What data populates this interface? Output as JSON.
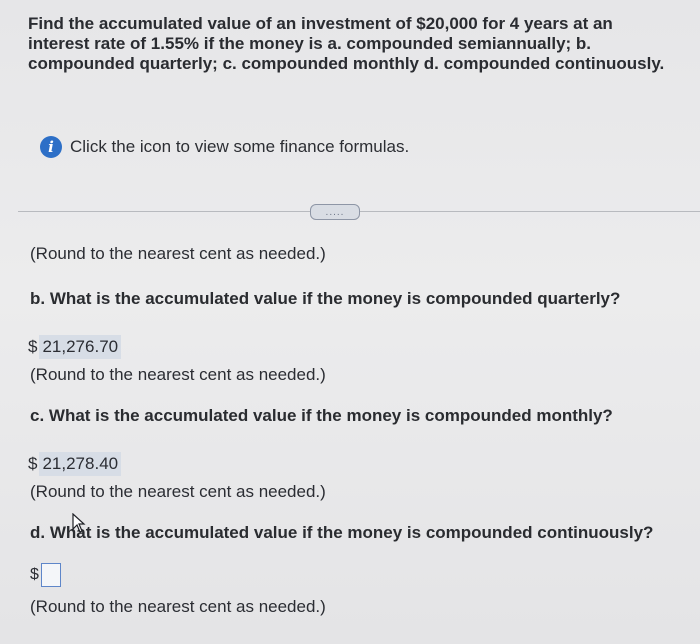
{
  "question": {
    "text": "Find the accumulated value of an investment of $20,000 for 4 years at an interest rate of 1.55% if the money is a. compounded semiannually; b. compounded quarterly; c. compounded monthly d. compounded continuously."
  },
  "help": {
    "icon_glyph": "i",
    "text": "Click the icon to view some finance formulas."
  },
  "expand_button": {
    "label": "....."
  },
  "part_a": {
    "round_note": "(Round to the nearest cent as needed.)"
  },
  "part_b": {
    "prompt": "b. What is the accumulated value if the money is compounded quarterly?",
    "currency": "$",
    "answer": "21,276.70",
    "round_note": "(Round to the nearest cent as needed.)"
  },
  "part_c": {
    "prompt": "c. What is the accumulated value if the money is compounded monthly?",
    "currency": "$",
    "answer": "21,278.40",
    "round_note": "(Round to the nearest cent as needed.)"
  },
  "part_d": {
    "prompt": "d. What is the accumulated value if the money is compounded continuously?",
    "currency": "$",
    "answer": "",
    "round_note": "(Round to the nearest cent as needed.)"
  },
  "colors": {
    "info_icon": "#2d6fc7",
    "answer_highlight": "#d7dde6",
    "input_border": "#5e86c9"
  }
}
